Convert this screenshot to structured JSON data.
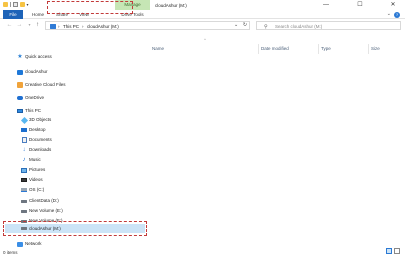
{
  "window": {
    "title": "cloudAshur (M:)",
    "manage_tab": "Manage",
    "minimize": "—",
    "maximize": "☐",
    "close": "✕"
  },
  "ribbon": {
    "tabs": [
      "File",
      "Home",
      "Share",
      "View",
      "Drive Tools"
    ],
    "expand_icon": "chevron-down-icon",
    "help_icon": "help-icon",
    "help_glyph": "?",
    "expand_glyph": "⌄"
  },
  "address_bar": {
    "path": [
      "This PC",
      "cloudAshur (M:)"
    ],
    "separator": "›",
    "search_placeholder": "Search cloudAshur (M:)"
  },
  "columns": [
    "Name",
    "Date modified",
    "Type",
    "Size"
  ],
  "sort_indicator": "^",
  "navigation": [
    {
      "label": "Quick access",
      "icon": "star-icon"
    },
    {
      "label": "cloudAshur",
      "icon": "cloud-folder-icon"
    },
    {
      "label": "Creative Cloud Files",
      "icon": "creative-cloud-icon"
    },
    {
      "label": "OneDrive",
      "icon": "onedrive-icon"
    },
    {
      "label": "This PC",
      "icon": "computer-icon"
    },
    {
      "label": "3D Objects",
      "icon": "cube-icon"
    },
    {
      "label": "Desktop",
      "icon": "desktop-icon"
    },
    {
      "label": "Documents",
      "icon": "document-icon"
    },
    {
      "label": "Downloads",
      "icon": "download-icon"
    },
    {
      "label": "Music",
      "icon": "music-icon"
    },
    {
      "label": "Pictures",
      "icon": "pictures-icon"
    },
    {
      "label": "Videos",
      "icon": "video-icon"
    },
    {
      "label": "OS (C:)",
      "icon": "os-drive-icon"
    },
    {
      "label": "ClientData (D:)",
      "icon": "drive-icon"
    },
    {
      "label": "New Volume (E:)",
      "icon": "drive-icon"
    },
    {
      "label": "New Volume (F:)",
      "icon": "drive-icon"
    },
    {
      "label": "cloudAshur (M:)",
      "icon": "drive-icon",
      "selected": true
    },
    {
      "label": "Network",
      "icon": "network-icon"
    }
  ],
  "status": {
    "item_count": "0 items"
  },
  "colors": {
    "file_tab": "#1d63b8",
    "manage_tab": "#c6e6b5",
    "selection": "#cce4f7",
    "highlight_dash": "#c23a3a"
  }
}
